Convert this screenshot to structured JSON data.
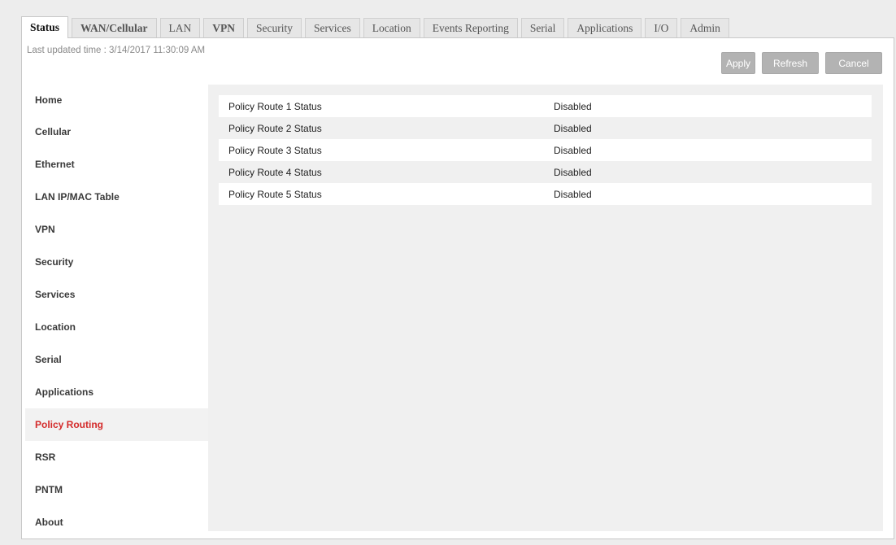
{
  "tabs": [
    {
      "label": "Status",
      "active": true
    },
    {
      "label": "WAN/Cellular",
      "bold": true
    },
    {
      "label": "LAN"
    },
    {
      "label": "VPN",
      "bold": true
    },
    {
      "label": "Security"
    },
    {
      "label": "Services"
    },
    {
      "label": "Location"
    },
    {
      "label": "Events Reporting"
    },
    {
      "label": "Serial"
    },
    {
      "label": "Applications"
    },
    {
      "label": "I/O"
    },
    {
      "label": "Admin"
    }
  ],
  "header": {
    "last_updated": "Last updated time : 3/14/2017 11:30:09 AM"
  },
  "actions": {
    "apply": "Apply",
    "refresh": "Refresh",
    "cancel": "Cancel"
  },
  "sidebar": {
    "items": [
      {
        "label": "Home"
      },
      {
        "label": "Cellular"
      },
      {
        "label": "Ethernet"
      },
      {
        "label": "LAN IP/MAC Table"
      },
      {
        "label": "VPN"
      },
      {
        "label": "Security"
      },
      {
        "label": "Services"
      },
      {
        "label": "Location"
      },
      {
        "label": "Serial"
      },
      {
        "label": "Applications"
      },
      {
        "label": "Policy Routing",
        "active": true
      },
      {
        "label": "RSR"
      },
      {
        "label": "PNTM"
      },
      {
        "label": "About"
      }
    ]
  },
  "status_rows": [
    {
      "label": "Policy Route 1 Status",
      "value": "Disabled"
    },
    {
      "label": "Policy Route 2 Status",
      "value": "Disabled"
    },
    {
      "label": "Policy Route 3 Status",
      "value": "Disabled"
    },
    {
      "label": "Policy Route 4 Status",
      "value": "Disabled"
    },
    {
      "label": "Policy Route 5 Status",
      "value": "Disabled"
    }
  ]
}
